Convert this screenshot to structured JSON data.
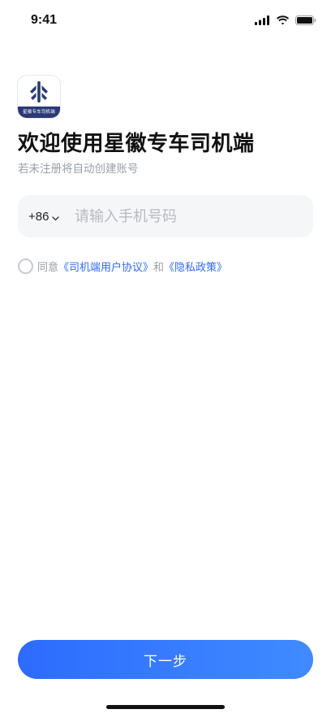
{
  "status_bar": {
    "time": "9:41",
    "icons": [
      "cellular-signal-icon",
      "wifi-icon",
      "battery-icon"
    ]
  },
  "app": {
    "logo_text": "星徽专车司机端"
  },
  "login": {
    "title": "欢迎使用星徽专车司机端",
    "subtitle": "若未注册将自动创建账号",
    "country_code": "+86",
    "phone_placeholder": "请输入手机号码",
    "phone_value": ""
  },
  "agreement": {
    "prefix": "同意",
    "user_agreement": "《司机端用户协议》",
    "conjunction": "和",
    "privacy_policy": "《隐私政策》",
    "checked": false
  },
  "actions": {
    "next_label": "下一步"
  },
  "colors": {
    "accent": "#2f6bff",
    "logo_band": "#2a3a78",
    "input_bg": "#f5f6f8",
    "muted_text": "#9aa0a8"
  }
}
